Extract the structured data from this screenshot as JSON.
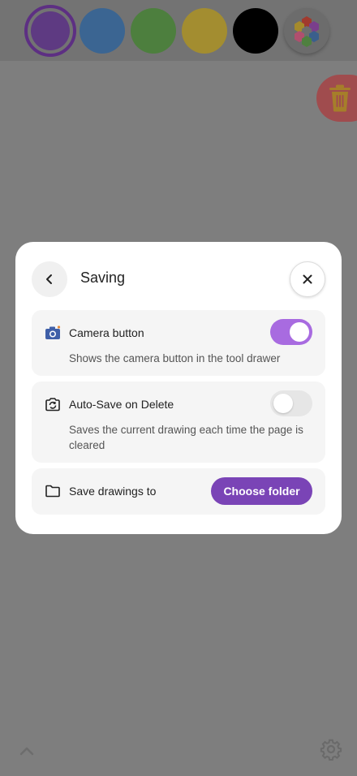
{
  "toolbar": {
    "colors": [
      {
        "name": "purple",
        "hex": "#5e3a82",
        "selected": true
      },
      {
        "name": "blue",
        "hex": "#3b6592",
        "selected": false
      },
      {
        "name": "green",
        "hex": "#4d7f3e",
        "selected": false
      },
      {
        "name": "yellow",
        "hex": "#a38d30",
        "selected": false
      },
      {
        "name": "black",
        "hex": "#000000",
        "selected": false
      }
    ],
    "palette_icon": "hexagon-palette-icon"
  },
  "trash_icon": "trash-icon",
  "bottom": {
    "expand_icon": "chevron-up-icon",
    "settings_icon": "gear-icon"
  },
  "dialog": {
    "title": "Saving",
    "back_icon": "chevron-left-icon",
    "close_icon": "close-icon",
    "camera": {
      "icon": "camera-icon",
      "label": "Camera button",
      "description": "Shows the camera button in the tool drawer",
      "enabled": true
    },
    "autosave": {
      "icon": "camera-rotate-icon",
      "label": "Auto-Save on Delete",
      "description": "Saves the current drawing each time the page is cleared",
      "enabled": false
    },
    "folder": {
      "icon": "folder-icon",
      "label": "Save drawings to",
      "button_label": "Choose folder"
    }
  },
  "colors": {
    "accent": "#7a44b6",
    "toggle_on": "#a86be0",
    "overlay": "#7e7e7e"
  }
}
